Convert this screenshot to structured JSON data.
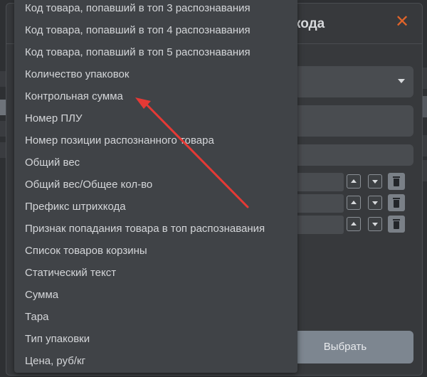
{
  "dialog": {
    "title_fragment": "кода",
    "close_symbol": "✕",
    "choose_button": "Выбрать"
  },
  "dropdown": {
    "options": [
      "Код товара, попавший в топ 3 распознавания",
      "Код товара, попавший в топ 4 распознавания",
      "Код товара, попавший в топ 5 распознавания",
      "Количество упаковок",
      "Контрольная сумма",
      "Номер ПЛУ",
      "Номер позиции распознанного товара",
      "Общий вес",
      "Общий вес/Общее кол-во",
      "Префикс штрихкода",
      "Признак попадания товара в топ распознавания",
      "Список товаров корзины",
      "Статический текст",
      "Сумма",
      "Тара",
      "Тип упаковки",
      "Цена, руб/кг"
    ]
  },
  "annotation": {
    "arrow_color": "#e53935"
  },
  "colors": {
    "accent_close": "#e0642a",
    "dialog_bg": "#37393c",
    "dropdown_bg": "#404347"
  }
}
